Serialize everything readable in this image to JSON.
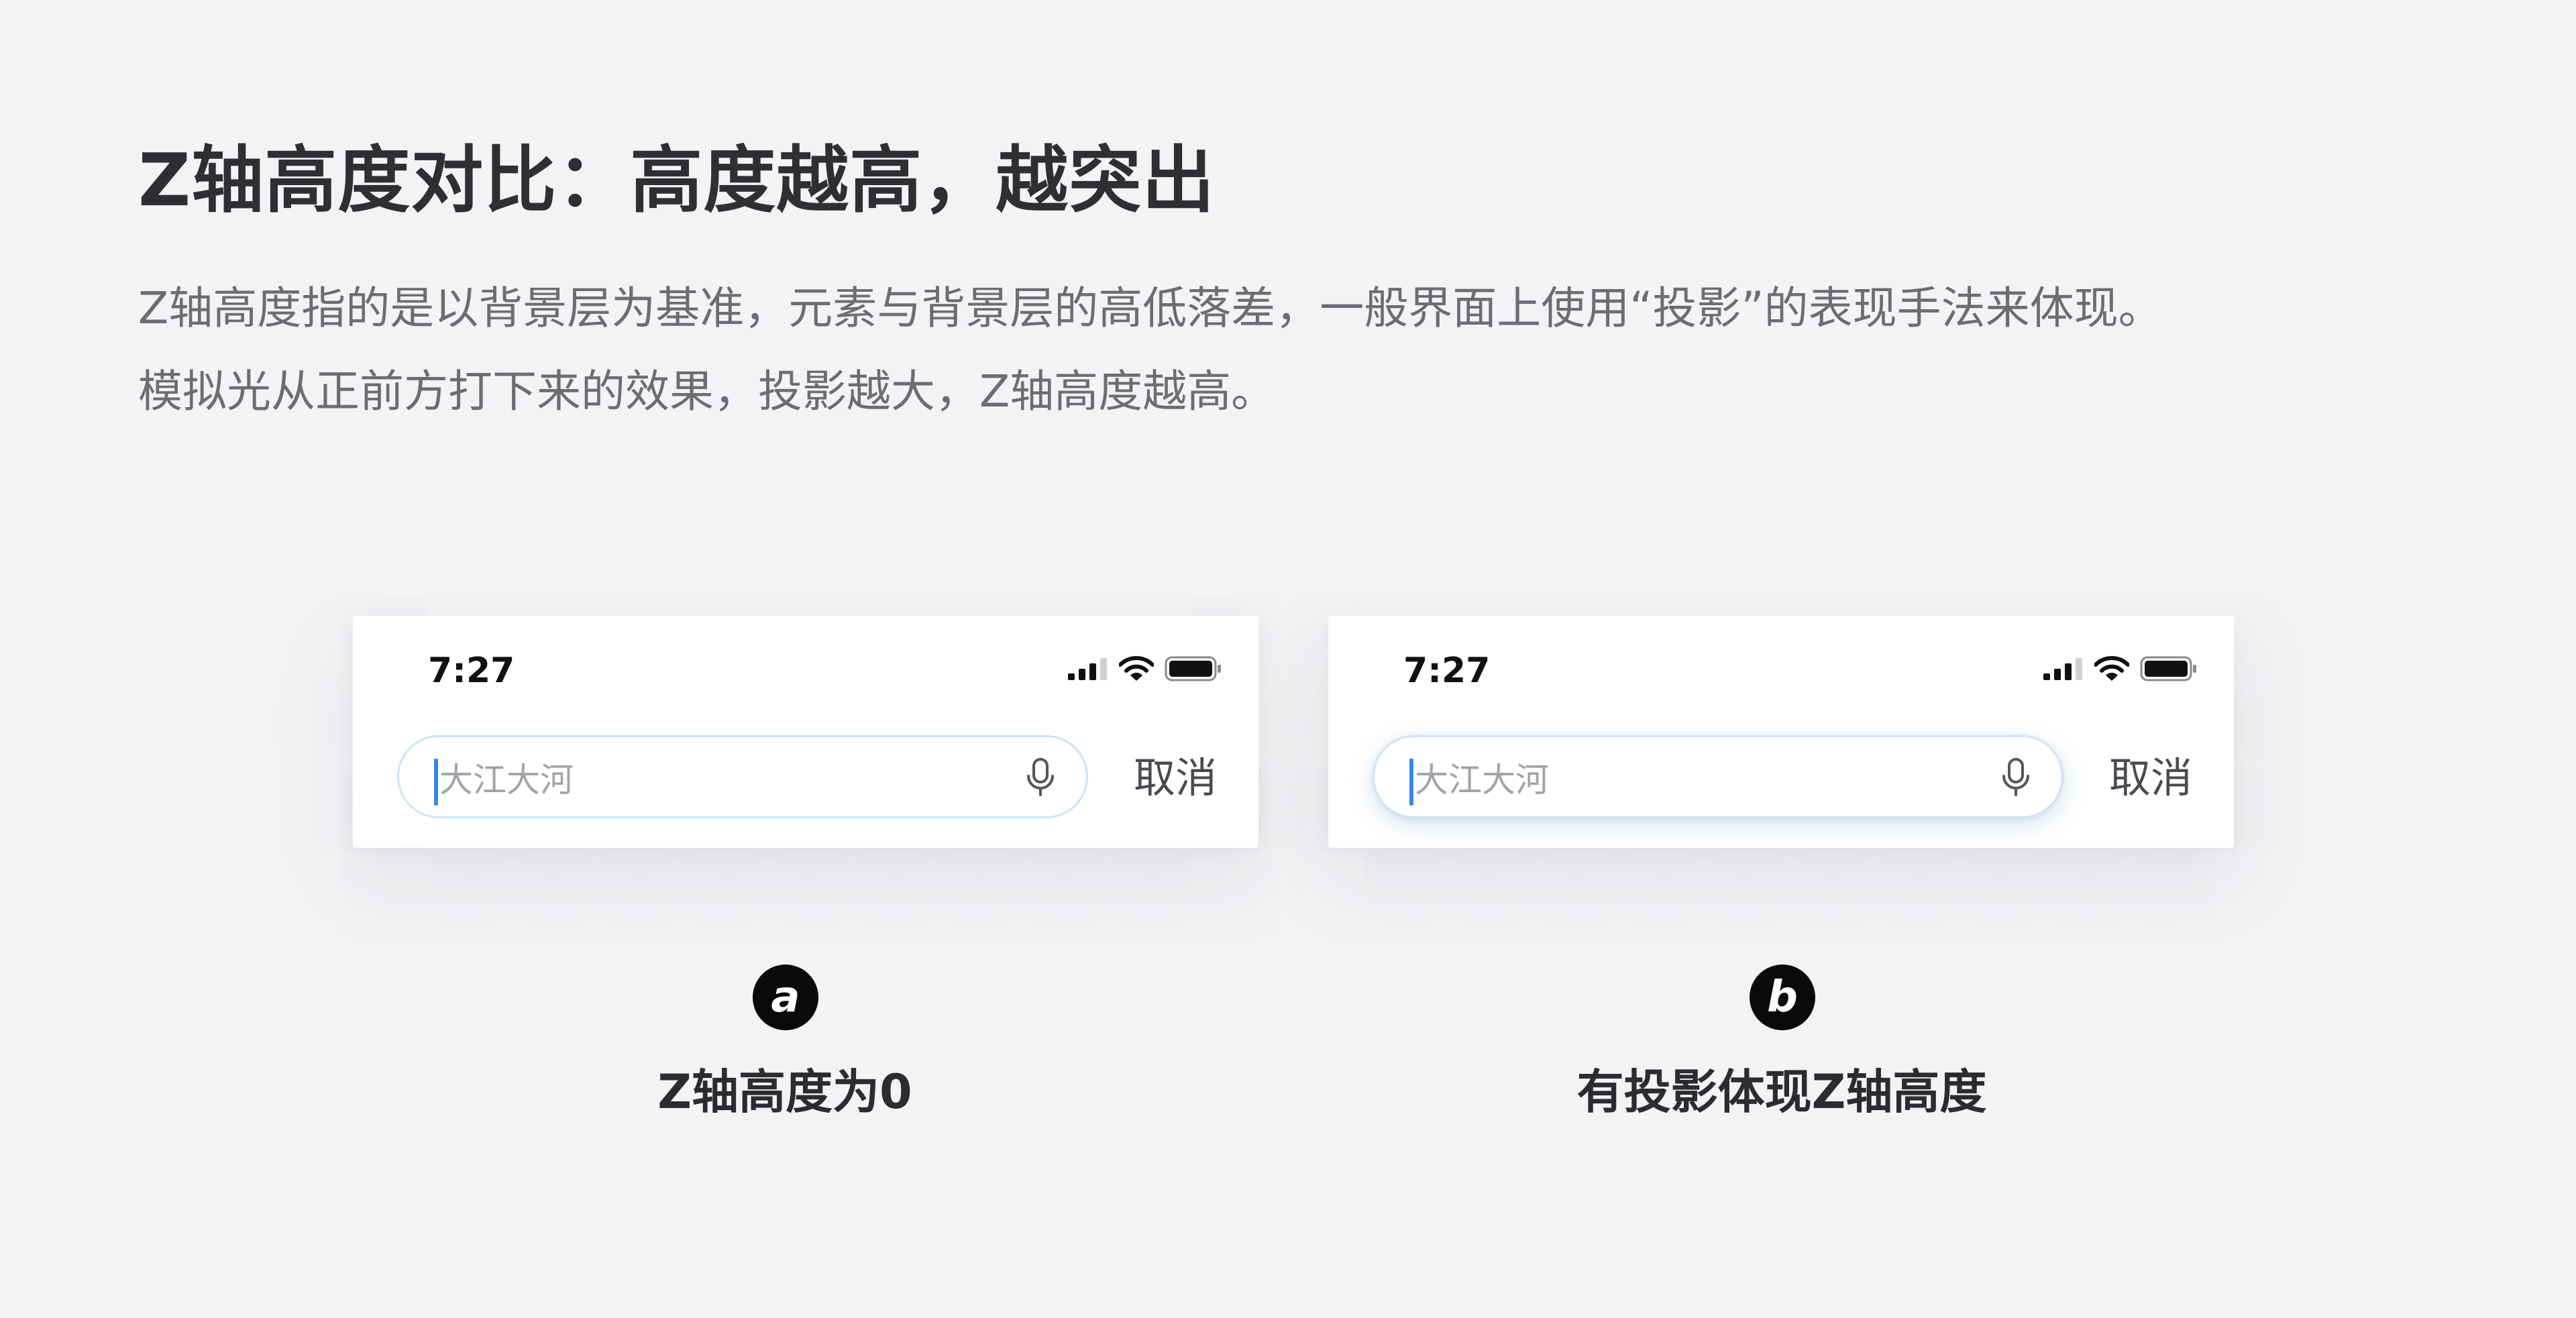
{
  "title": "Z轴高度对比：高度越高，越突出",
  "description": {
    "line1": "Z轴高度指的是以背景层为基准，元素与背景层的高低落差，一般界面上使用“投影”的表现手法来体现。",
    "line2": "模拟光从正前方打下来的效果，投影越大，Z轴高度越高。"
  },
  "examples": [
    {
      "status_time": "7:27",
      "search_placeholder": "大江大河",
      "cancel_label": "取消",
      "badge": "a",
      "caption": "Z轴高度为0"
    },
    {
      "status_time": "7:27",
      "search_placeholder": "大江大河",
      "cancel_label": "取消",
      "badge": "b",
      "caption": "有投影体现Z轴高度"
    }
  ],
  "icons": {
    "signal": "signal-icon",
    "wifi": "wifi-icon",
    "battery": "battery-icon",
    "mic": "mic-icon"
  },
  "colors": {
    "background": "#f2f3f5",
    "caret": "#3a86f0",
    "search_border": "#c9e5f7"
  }
}
